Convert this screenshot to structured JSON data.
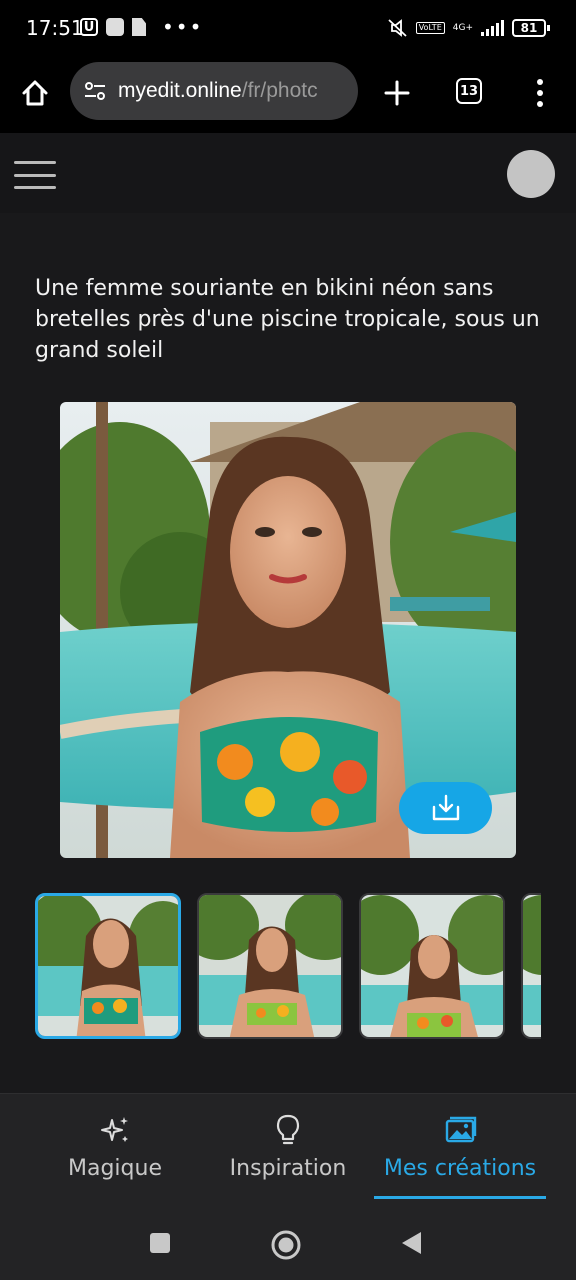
{
  "status_bar": {
    "time": "17:51",
    "left_icons": [
      "u-icon",
      "square-icon",
      "document-icon"
    ],
    "overflow": "•••",
    "network": "4G+",
    "volte": "VoLTE",
    "battery": "81"
  },
  "browser": {
    "url_domain": "myedit.online",
    "url_path": "/fr/photc",
    "tabs_count": "13"
  },
  "app": {
    "prompt": "Une femme souriante en bikini néon sans bretelles près d'une piscine tropicale, sous un grand soleil"
  },
  "thumbnails": [
    {
      "selected": true
    },
    {
      "selected": false
    },
    {
      "selected": false
    },
    {
      "selected": false
    }
  ],
  "bottom_nav": {
    "items": [
      {
        "label": "Magique",
        "icon": "sparkle-icon"
      },
      {
        "label": "Inspiration",
        "icon": "lightbulb-icon"
      },
      {
        "label": "Mes créations",
        "icon": "gallery-icon",
        "active": true
      }
    ]
  },
  "colors": {
    "accent": "#2aa9e6",
    "download_button": "#16a6e6",
    "content_bg": "#19191b",
    "nav_bg": "#232325"
  }
}
